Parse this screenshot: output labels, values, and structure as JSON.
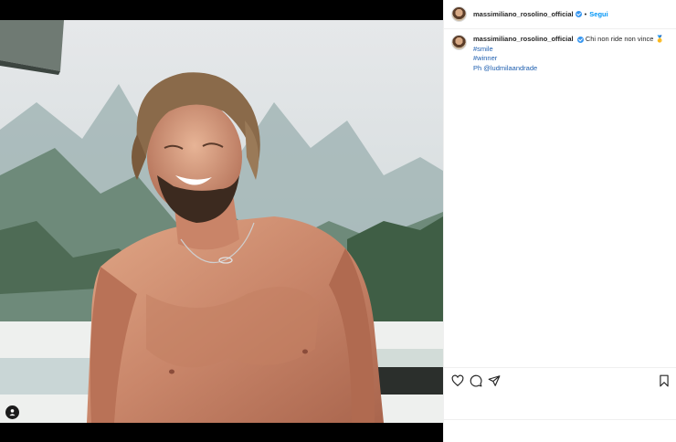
{
  "post": {
    "username": "massimiliano_rosolino_official",
    "follow_label": "Segui",
    "separator": "•",
    "caption": {
      "text": "Chi non ride non vince",
      "emoji": "🥇",
      "hashtags": [
        "#smile",
        "#winner"
      ],
      "credit_prefix": "Ph",
      "credit_mention": "@ludmilaandrade"
    }
  },
  "icons": {
    "like": "heart-icon",
    "comment": "comment-icon",
    "share": "send-icon",
    "save": "bookmark-icon",
    "tags": "user-tag-icon"
  },
  "colors": {
    "accent": "#0095f6",
    "verified": "#3897f0",
    "link": "#2060b0",
    "text": "#262626"
  }
}
